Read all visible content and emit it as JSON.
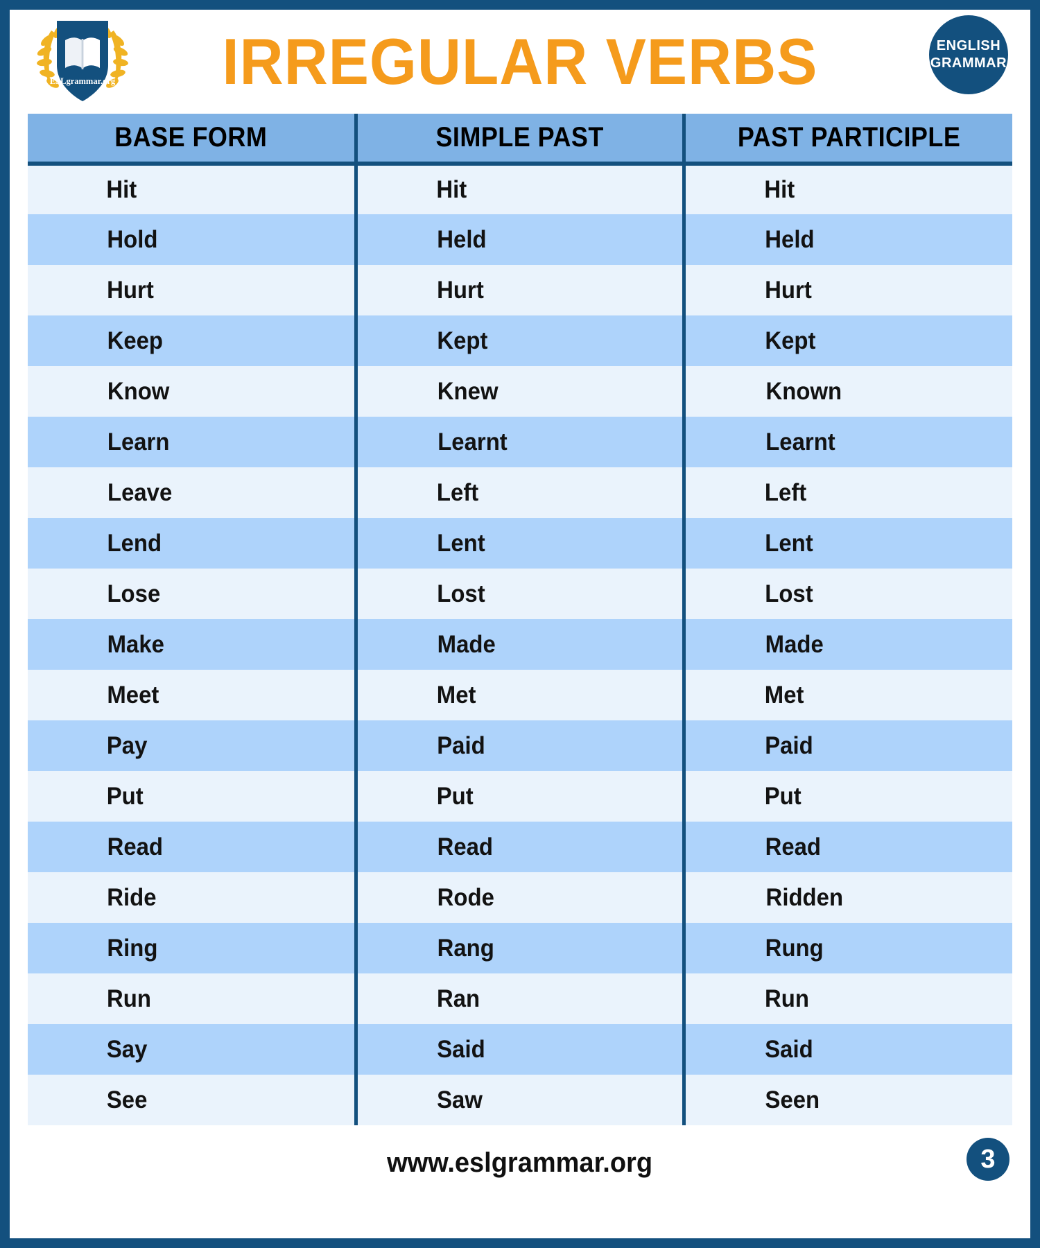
{
  "poster": {
    "title": "IRREGULAR VERBS",
    "border_color": "#13507e",
    "title_color": "#f59b1c",
    "header_row_color": "#7fb2e5",
    "row_odd_color": "#eaf3fc",
    "row_even_color": "#aed3fb"
  },
  "logo": {
    "name": "eslgrammar-shield-logo",
    "text": "ESLgrammar.org"
  },
  "badge": {
    "line1": "ENGLISH",
    "line2": "GRAMMAR"
  },
  "watermark": {
    "text": "www.eslgrammar.org"
  },
  "table": {
    "headers": [
      "BASE FORM",
      "SIMPLE PAST",
      "PAST PARTICIPLE"
    ],
    "rows": [
      [
        "Hit",
        "Hit",
        "Hit"
      ],
      [
        "Hold",
        "Held",
        "Held"
      ],
      [
        "Hurt",
        "Hurt",
        "Hurt"
      ],
      [
        "Keep",
        "Kept",
        "Kept"
      ],
      [
        "Know",
        "Knew",
        "Known"
      ],
      [
        "Learn",
        "Learnt",
        "Learnt"
      ],
      [
        "Leave",
        "Left",
        "Left"
      ],
      [
        "Lend",
        "Lent",
        "Lent"
      ],
      [
        "Lose",
        "Lost",
        "Lost"
      ],
      [
        "Make",
        "Made",
        "Made"
      ],
      [
        "Meet",
        "Met",
        "Met"
      ],
      [
        "Pay",
        "Paid",
        "Paid"
      ],
      [
        "Put",
        "Put",
        "Put"
      ],
      [
        "Read",
        "Read",
        "Read"
      ],
      [
        "Ride",
        "Rode",
        "Ridden"
      ],
      [
        "Ring",
        "Rang",
        "Rung"
      ],
      [
        "Run",
        "Ran",
        "Run"
      ],
      [
        "Say",
        "Said",
        "Said"
      ],
      [
        "See",
        "Saw",
        "Seen"
      ]
    ]
  },
  "footer": {
    "url": "www.eslgrammar.org",
    "page_number": "3"
  }
}
